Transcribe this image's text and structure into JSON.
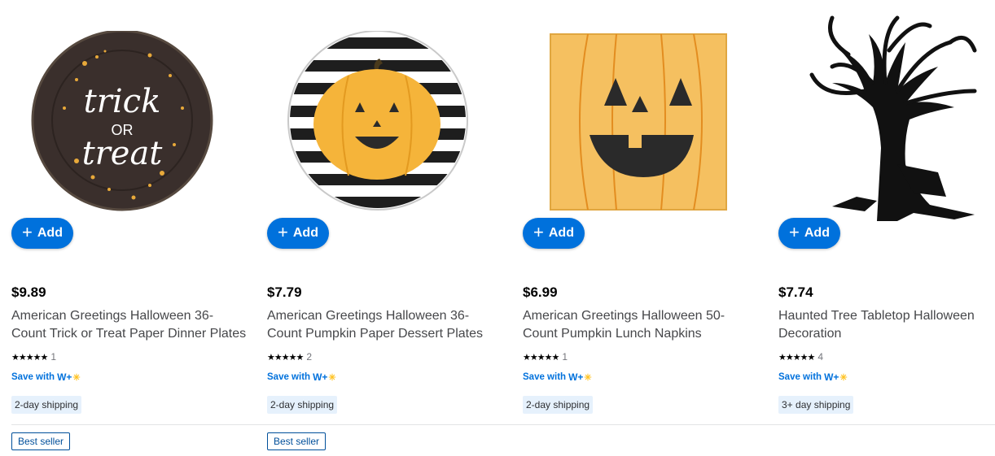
{
  "products": [
    {
      "image": "trick-or-treat-plate",
      "add_label": "Add",
      "price": "$9.89",
      "title": "American Greetings Halloween 36-Count Trick or Treat Paper Dinner Plates",
      "rating": 5,
      "review_count": "1",
      "save_text": "Save with",
      "save_brand": "W+",
      "shipping": "2-day shipping",
      "badge": "Best seller"
    },
    {
      "image": "pumpkin-striped-plate",
      "add_label": "Add",
      "price": "$7.79",
      "title": "American Greetings Halloween 36-Count Pumpkin Paper Dessert Plates",
      "rating": 5,
      "review_count": "2",
      "save_text": "Save with",
      "save_brand": "W+",
      "shipping": "2-day shipping",
      "badge": "Best seller"
    },
    {
      "image": "pumpkin-napkin",
      "add_label": "Add",
      "price": "$6.99",
      "title": "American Greetings Halloween 50-Count Pumpkin Lunch Napkins",
      "rating": 5,
      "review_count": "1",
      "save_text": "Save with",
      "save_brand": "W+",
      "shipping": "2-day shipping",
      "badge": ""
    },
    {
      "image": "haunted-tree",
      "add_label": "Add",
      "price": "$7.74",
      "title": "Haunted Tree Tabletop Halloween Decoration",
      "rating": 5,
      "review_count": "4",
      "save_text": "Save with",
      "save_brand": "W+",
      "shipping": "3+ day shipping",
      "badge": ""
    }
  ],
  "plate_text": {
    "line1": "trick",
    "line2": "OR",
    "line3": "treat"
  },
  "colors": {
    "accent": "#0071dc",
    "spark": "#ffc220",
    "shipping_bg": "#e6f1fc",
    "badge": "#004f9a"
  }
}
